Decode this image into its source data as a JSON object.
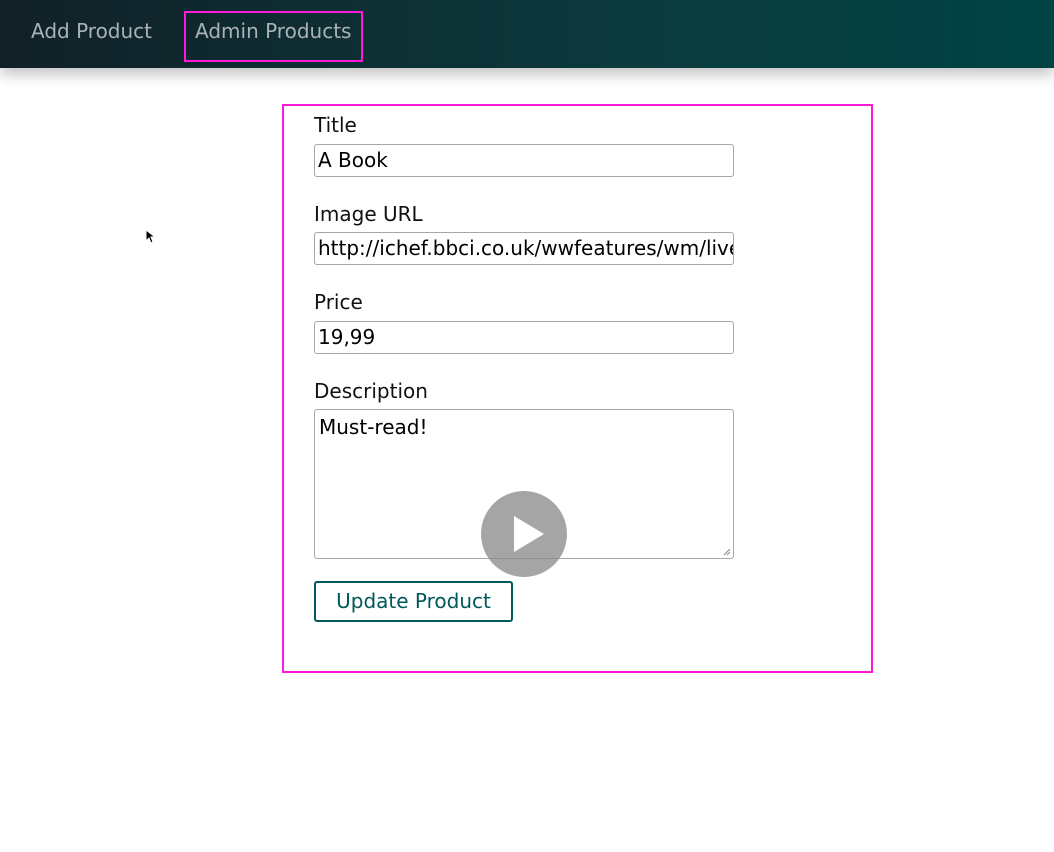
{
  "nav": {
    "add_product": "Add Product",
    "admin_products": "Admin Products"
  },
  "form": {
    "title_label": "Title",
    "title_value": "A Book",
    "image_url_label": "Image URL",
    "image_url_value": "http://ichef.bbci.co.uk/wwfeatures/wm/live",
    "price_label": "Price",
    "price_value": "19,99",
    "description_label": "Description",
    "description_value": "Must-read!",
    "submit_label": "Update Product"
  },
  "icons": {
    "video_overlay": "play-icon",
    "pointer": "mouse-cursor-icon"
  },
  "colors": {
    "header_gradient_start": "#112027",
    "header_gradient_end": "#004343",
    "accent": "#00585a",
    "highlight": "#ff1ad9"
  }
}
